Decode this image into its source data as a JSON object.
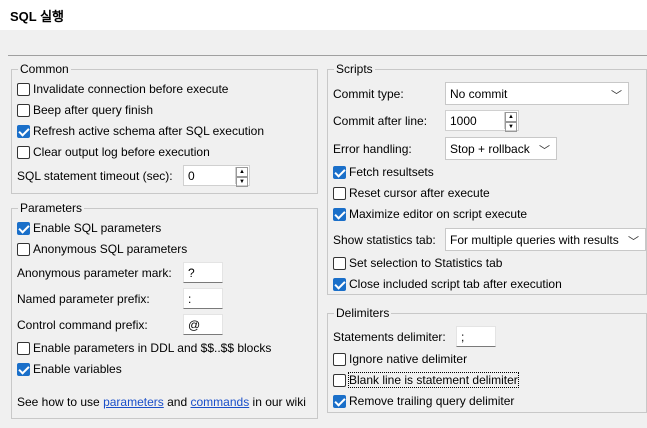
{
  "title": "SQL 실행",
  "common": {
    "title": "Common",
    "invalidate": "Invalidate connection before execute",
    "beep": "Beep after query finish",
    "refresh": "Refresh active schema after SQL execution",
    "clear_log": "Clear output log before execution",
    "timeout_label": "SQL statement timeout (sec):",
    "timeout_value": "0",
    "checked": {
      "invalidate": false,
      "beep": false,
      "refresh": true,
      "clear_log": false
    }
  },
  "parameters": {
    "title": "Parameters",
    "enable_sql": "Enable SQL parameters",
    "anonymous": "Anonymous SQL parameters",
    "anon_mark_label": "Anonymous parameter mark:",
    "anon_mark_value": "?",
    "named_prefix_label": "Named parameter prefix:",
    "named_prefix_value": ":",
    "control_prefix_label": "Control command prefix:",
    "control_prefix_value": "@",
    "ddl_blocks": "Enable parameters in DDL and $$..$$ blocks",
    "variables": "Enable variables",
    "help_prefix": "See how to use",
    "help_link1": "parameters",
    "help_and": "and",
    "help_link2": "commands",
    "help_suffix": "in our wiki",
    "checked": {
      "enable_sql": true,
      "anonymous": false,
      "ddl_blocks": false,
      "variables": true
    }
  },
  "scripts": {
    "title": "Scripts",
    "commit_type_label": "Commit type:",
    "commit_type_value": "No commit",
    "commit_after_label": "Commit after line:",
    "commit_after_value": "1000",
    "error_label": "Error handling:",
    "error_value": "Stop + rollback",
    "fetch": "Fetch resultsets",
    "reset_cursor": "Reset cursor after execute",
    "maximize": "Maximize editor on script execute",
    "stats_label": "Show statistics tab:",
    "stats_value": "For multiple queries with results",
    "set_selection": "Set selection to Statistics tab",
    "close_included": "Close included script tab after execution",
    "checked": {
      "fetch": true,
      "reset_cursor": false,
      "maximize": true,
      "set_selection": false,
      "close_included": true
    }
  },
  "delimiters": {
    "title": "Delimiters",
    "stmt_label": "Statements delimiter:",
    "stmt_value": ";",
    "ignore_native": "Ignore native delimiter",
    "blank_line": "Blank line is statement delimiter",
    "remove_trailing": "Remove trailing query delimiter",
    "checked": {
      "ignore_native": false,
      "blank_line": false,
      "remove_trailing": true
    }
  }
}
